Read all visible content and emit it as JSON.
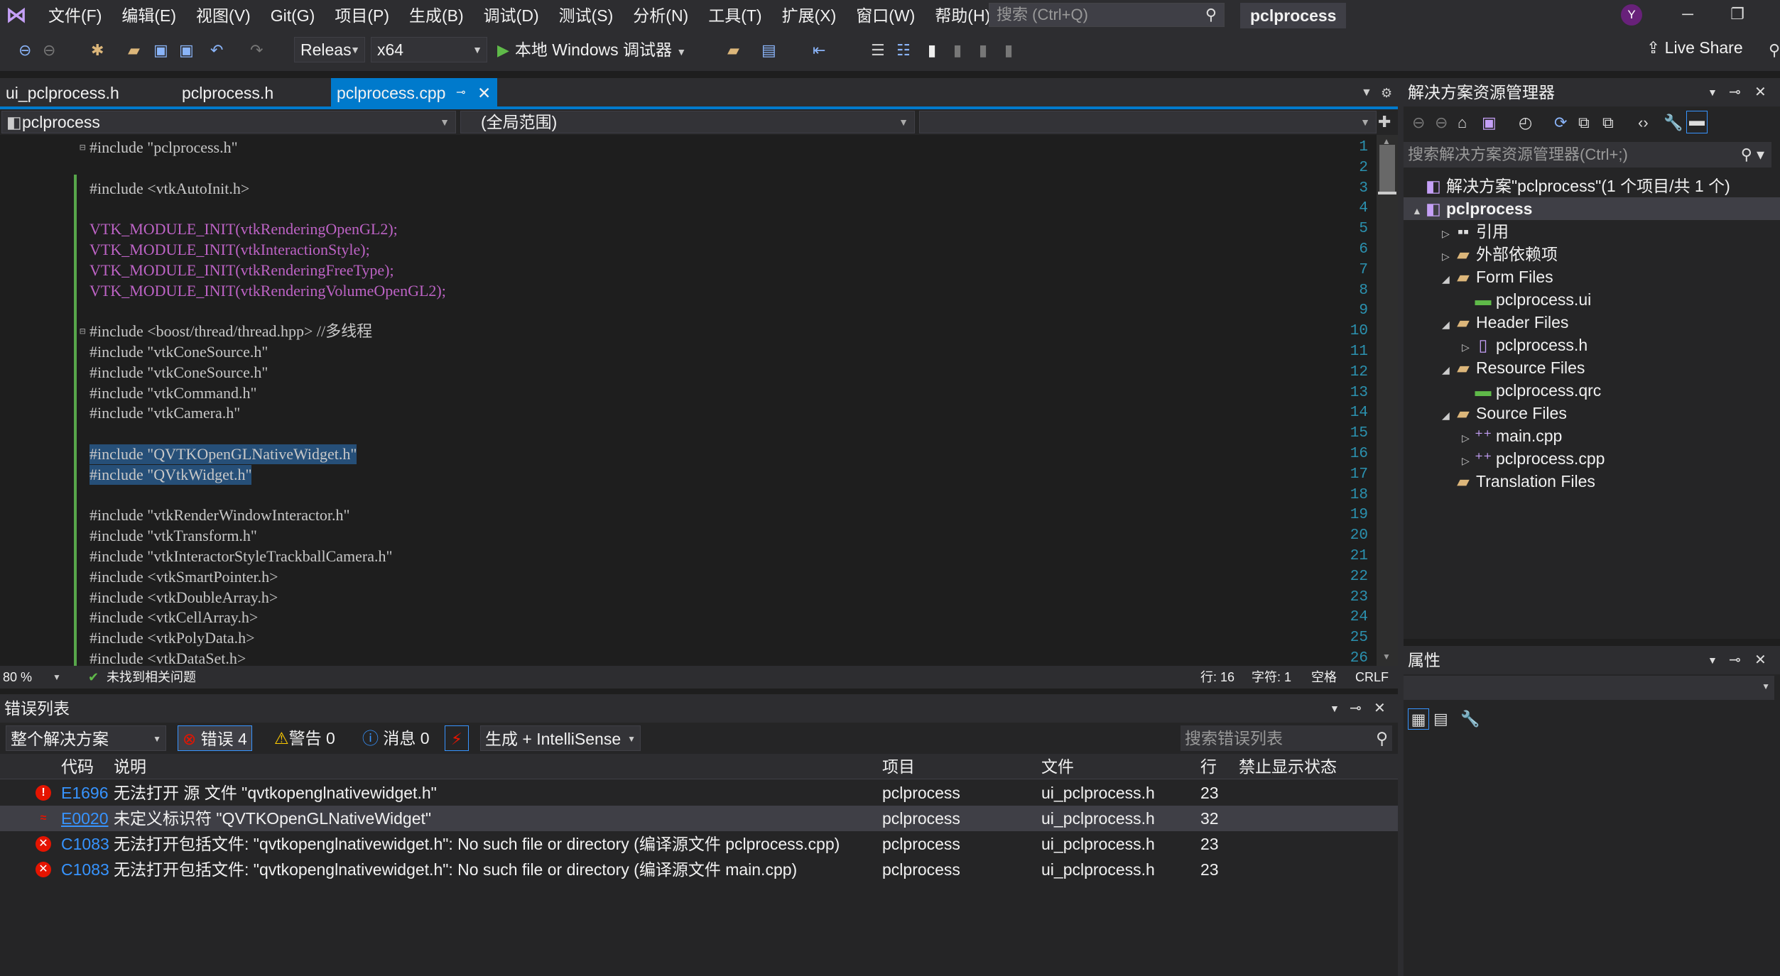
{
  "menubar": {
    "items": [
      "文件(F)",
      "编辑(E)",
      "视图(V)",
      "Git(G)",
      "项目(P)",
      "生成(B)",
      "调试(D)",
      "测试(S)",
      "分析(N)",
      "工具(T)",
      "扩展(X)",
      "窗口(W)",
      "帮助(H)"
    ],
    "search_placeholder": "搜索 (Ctrl+Q)",
    "project_title": "pclprocess",
    "avatar": "Y"
  },
  "toolbar": {
    "config": "Releas",
    "platform": "x64",
    "run_label": "本地 Windows 调试器",
    "live_share": "Live Share"
  },
  "tabs": [
    {
      "label": "ui_pclprocess.h"
    },
    {
      "label": "pclprocess.h"
    },
    {
      "label": "pclprocess.cpp",
      "active": true
    }
  ],
  "navbar": {
    "project": "pclprocess",
    "scope": "(全局范围)"
  },
  "code_lines": [
    {
      "n": "1",
      "text": "#include \"pclprocess.h\""
    },
    {
      "n": "2",
      "text": ""
    },
    {
      "n": "3",
      "text": "#include <vtkAutoInit.h>"
    },
    {
      "n": "4",
      "text": ""
    },
    {
      "n": "5",
      "text": "VTK_MODULE_INIT(vtkRenderingOpenGL2);"
    },
    {
      "n": "6",
      "text": "VTK_MODULE_INIT(vtkInteractionStyle);"
    },
    {
      "n": "7",
      "text": "VTK_MODULE_INIT(vtkRenderingFreeType);"
    },
    {
      "n": "8",
      "text": "VTK_MODULE_INIT(vtkRenderingVolumeOpenGL2);"
    },
    {
      "n": "9",
      "text": ""
    },
    {
      "n": "10",
      "text": "#include <boost/thread/thread.hpp> //多线程"
    },
    {
      "n": "11",
      "text": "#include \"vtkConeSource.h\""
    },
    {
      "n": "12",
      "text": "#include \"vtkConeSource.h\""
    },
    {
      "n": "13",
      "text": "#include \"vtkCommand.h\""
    },
    {
      "n": "14",
      "text": "#include \"vtkCamera.h\""
    },
    {
      "n": "15",
      "text": ""
    },
    {
      "n": "16",
      "text": "#include \"QVTKOpenGLNativeWidget.h\""
    },
    {
      "n": "17",
      "text": "#include \"QVtkWidget.h\""
    },
    {
      "n": "18",
      "text": ""
    },
    {
      "n": "19",
      "text": "#include \"vtkRenderWindowInteractor.h\""
    },
    {
      "n": "20",
      "text": "#include \"vtkTransform.h\""
    },
    {
      "n": "21",
      "text": "#include \"vtkInteractorStyleTrackballCamera.h\""
    },
    {
      "n": "22",
      "text": "#include <vtkSmartPointer.h>"
    },
    {
      "n": "23",
      "text": "#include <vtkDoubleArray.h>"
    },
    {
      "n": "24",
      "text": "#include <vtkCellArray.h>"
    },
    {
      "n": "25",
      "text": "#include <vtkPolyData.h>"
    },
    {
      "n": "26",
      "text": "#include <vtkDataSet.h>"
    }
  ],
  "editor_status": {
    "zoom": "80 %",
    "issues": "未找到相关问题",
    "line": "行: 16",
    "char": "字符: 1",
    "spaces": "空格",
    "eol": "CRLF"
  },
  "error_list": {
    "title": "错误列表",
    "scope": "整个解决方案",
    "errors": "错误 4",
    "warnings": "警告 0",
    "messages": "消息 0",
    "source": "生成 + IntelliSense",
    "search_placeholder": "搜索错误列表",
    "columns": [
      "代码",
      "说明",
      "项目",
      "文件",
      "行",
      "禁止显示状态"
    ],
    "rows": [
      {
        "code": "E1696",
        "desc": "无法打开 源 文件 \"qvtkopenglnativewidget.h\"",
        "project": "pclprocess",
        "file": "ui_pclprocess.h",
        "line": "23"
      },
      {
        "code": "E0020",
        "desc": "未定义标识符 \"QVTKOpenGLNativeWidget\"",
        "project": "pclprocess",
        "file": "ui_pclprocess.h",
        "line": "32"
      },
      {
        "code": "C1083",
        "desc": "无法打开包括文件: \"qvtkopenglnativewidget.h\": No such file or directory (编译源文件 pclprocess.cpp)",
        "project": "pclprocess",
        "file": "ui_pclprocess.h",
        "line": "23"
      },
      {
        "code": "C1083",
        "desc": "无法打开包括文件: \"qvtkopenglnativewidget.h\": No such file or directory (编译源文件 main.cpp)",
        "project": "pclprocess",
        "file": "ui_pclprocess.h",
        "line": "23"
      }
    ]
  },
  "solution_explorer": {
    "title": "解决方案资源管理器",
    "search_placeholder": "搜索解决方案资源管理器(Ctrl+;)",
    "tree": [
      {
        "label": "解决方案\"pclprocess\"(1 个项目/共 1 个)",
        "depth": 0,
        "twisty": "",
        "icon": "solution-icon"
      },
      {
        "label": "pclprocess",
        "depth": 0,
        "twisty": "▲",
        "icon": "project-icon",
        "bold": true
      },
      {
        "label": "引用",
        "depth": 1,
        "twisty": "▷",
        "icon": "references-icon"
      },
      {
        "label": "外部依赖项",
        "depth": 1,
        "twisty": "▷",
        "icon": "external-deps-icon"
      },
      {
        "label": "Form Files",
        "depth": 1,
        "twisty": "◢",
        "icon": "folder-icon"
      },
      {
        "label": "pclprocess.ui",
        "depth": 2,
        "twisty": "",
        "icon": "ui-file-icon"
      },
      {
        "label": "Header Files",
        "depth": 1,
        "twisty": "◢",
        "icon": "folder-icon"
      },
      {
        "label": "pclprocess.h",
        "depth": 2,
        "twisty": "▷",
        "icon": "header-file-icon"
      },
      {
        "label": "Resource Files",
        "depth": 1,
        "twisty": "◢",
        "icon": "folder-icon"
      },
      {
        "label": "pclprocess.qrc",
        "depth": 2,
        "twisty": "",
        "icon": "qrc-file-icon"
      },
      {
        "label": "Source Files",
        "depth": 1,
        "twisty": "◢",
        "icon": "folder-icon"
      },
      {
        "label": "main.cpp",
        "depth": 2,
        "twisty": "▷",
        "icon": "cpp-file-icon"
      },
      {
        "label": "pclprocess.cpp",
        "depth": 2,
        "twisty": "▷",
        "icon": "cpp-file-icon"
      },
      {
        "label": "Translation Files",
        "depth": 1,
        "twisty": "",
        "icon": "folder-icon"
      }
    ]
  },
  "properties": {
    "title": "属性"
  }
}
